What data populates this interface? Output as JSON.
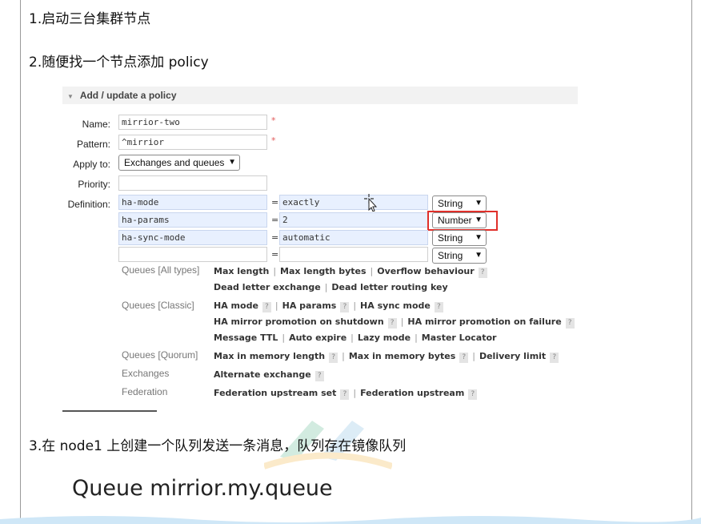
{
  "steps": {
    "step1": "1.启动三台集群节点",
    "step2": "2.随便找一个节点添加 policy",
    "step3": "3.在 node1 上创建一个队列发送一条消息，队列存在镜像队列"
  },
  "policy_form": {
    "section_title": "Add / update a policy",
    "name_label": "Name:",
    "name_value": "mirrior-two",
    "pattern_label": "Pattern:",
    "pattern_value": "^mirrior",
    "required_mark": "*",
    "apply_to_label": "Apply to:",
    "apply_to_value": "Exchanges and queues",
    "priority_label": "Priority:",
    "priority_value": "",
    "definition_label": "Definition:",
    "definitions": [
      {
        "key": "ha-mode",
        "eq": "=",
        "value": "exactly",
        "type": "String"
      },
      {
        "key": "ha-params",
        "eq": "=",
        "value": "2",
        "type": "Number"
      },
      {
        "key": "ha-sync-mode",
        "eq": "=",
        "value": "automatic",
        "type": "String"
      },
      {
        "key": "",
        "eq": "=",
        "value": "",
        "type": "String"
      }
    ],
    "highlighted_row_index": 1,
    "highlight_color": "#e0302a"
  },
  "categories": {
    "queues_all": {
      "label": "Queues [All types]",
      "line1": [
        "Max length",
        "Max length bytes",
        "Overflow behaviour"
      ],
      "line2": [
        "Dead letter exchange",
        "Dead letter routing key"
      ]
    },
    "queues_classic": {
      "label": "Queues [Classic]",
      "line1": [
        "HA mode",
        "HA params",
        "HA sync mode"
      ],
      "line2": [
        "HA mirror promotion on shutdown",
        "HA mirror promotion on failure"
      ],
      "line3": [
        "Message TTL",
        "Auto expire",
        "Lazy mode",
        "Master Locator"
      ]
    },
    "queues_quorum": {
      "label": "Queues [Quorum]",
      "line1": [
        "Max in memory length",
        "Max in memory bytes",
        "Delivery limit"
      ]
    },
    "exchanges": {
      "label": "Exchanges",
      "line1": [
        "Alternate exchange"
      ]
    },
    "federation": {
      "label": "Federation",
      "line1": [
        "Federation upstream set",
        "Federation upstream"
      ]
    },
    "help_mark": "?",
    "separator": "|"
  },
  "queue_heading": {
    "prefix": "Queue",
    "name": "mirrior.my.queue"
  },
  "icons": {
    "collapse": "triangle-down-icon",
    "dropdown": "chevron-down-icon",
    "cursor": "move-cursor-icon"
  }
}
